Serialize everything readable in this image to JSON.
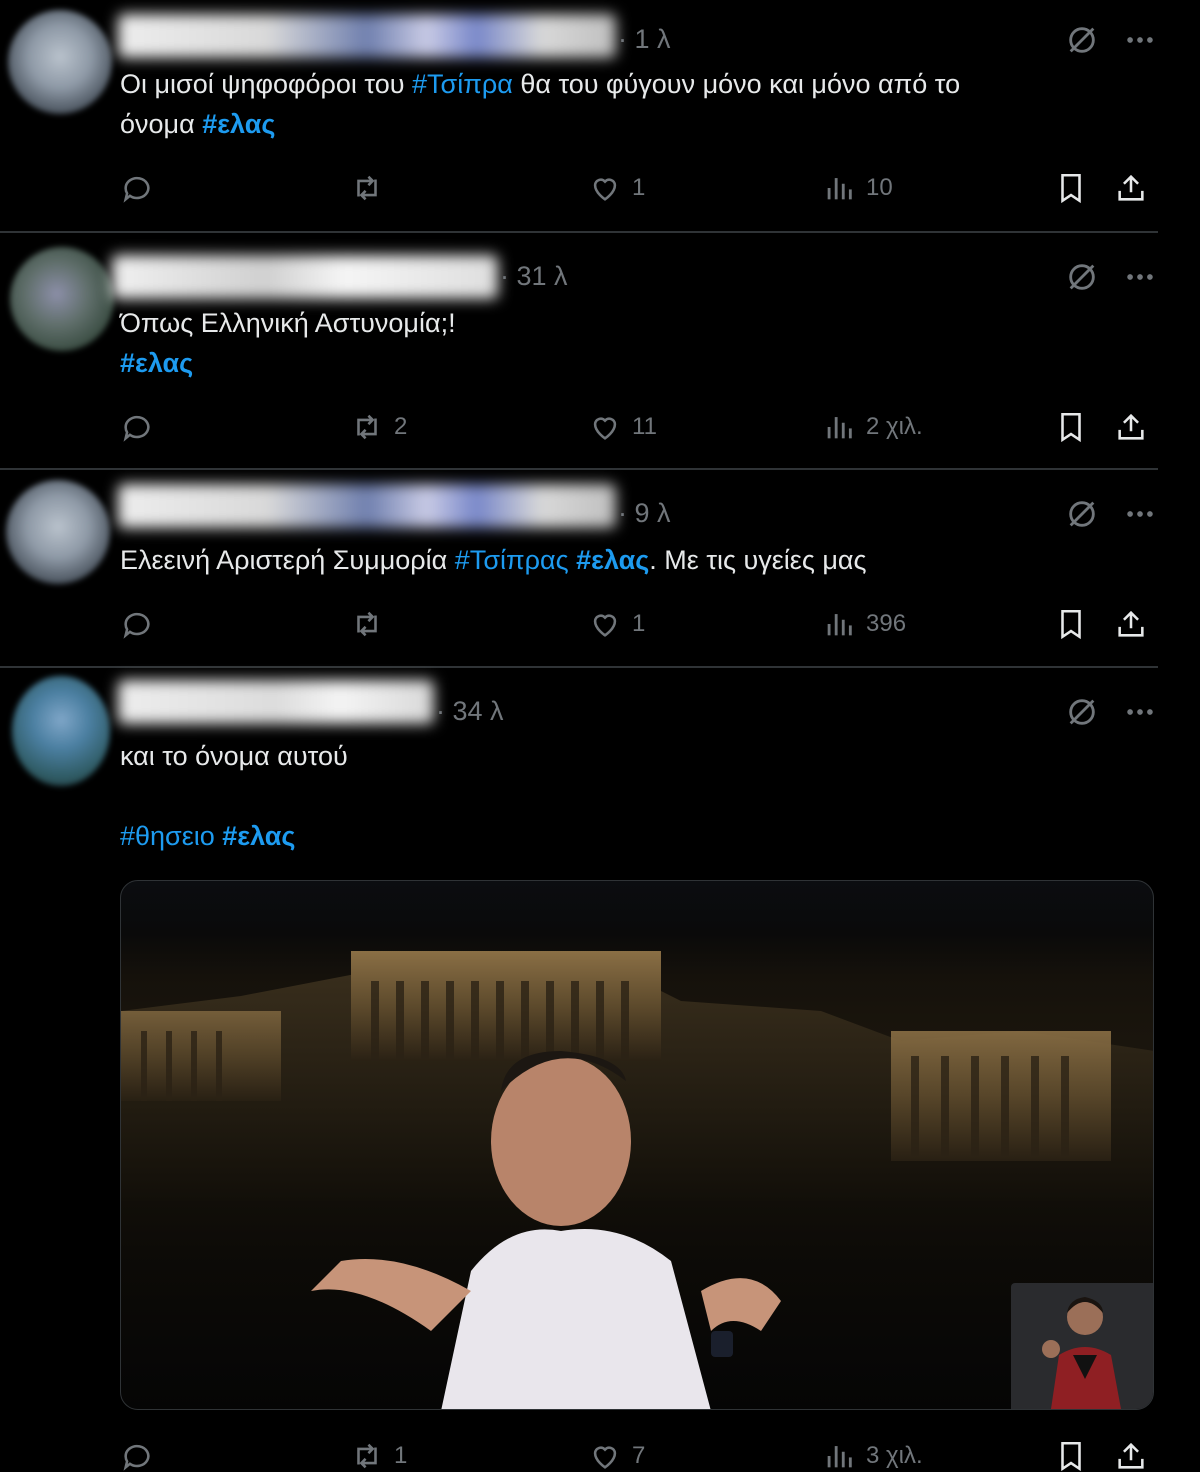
{
  "tweets": [
    {
      "time": "· 1 λ",
      "text_parts": [
        {
          "t": "Οι μισοί ψηφοφόροι του ",
          "tag": false
        },
        {
          "t": "#Τσίπρα",
          "tag": true,
          "bold": false
        },
        {
          "t": " θα του φύγουν μόνο και μόνο από το\nόνομα ",
          "tag": false
        },
        {
          "t": "#ελας",
          "tag": true,
          "bold": true
        }
      ],
      "replies": "",
      "reposts": "",
      "likes": "1",
      "views": "10"
    },
    {
      "time": "· 31 λ",
      "text_parts": [
        {
          "t": "Όπως Ελληνική Αστυνομία;!\n",
          "tag": false
        },
        {
          "t": "#ελας",
          "tag": true,
          "bold": true
        }
      ],
      "replies": "",
      "reposts": "2",
      "likes": "11",
      "views": "2 χιλ."
    },
    {
      "time": "· 9 λ",
      "text_parts": [
        {
          "t": "Ελεεινή Αριστερή Συμμορία ",
          "tag": false
        },
        {
          "t": "#Τσίπρας",
          "tag": true,
          "bold": false
        },
        {
          "t": " ",
          "tag": false
        },
        {
          "t": "#ελας",
          "tag": true,
          "bold": true
        },
        {
          "t": ". Με τις υγείες μας",
          "tag": false
        }
      ],
      "replies": "",
      "reposts": "",
      "likes": "1",
      "views": "396"
    },
    {
      "time": "· 34 λ",
      "text_parts": [
        {
          "t": "και το όνομα αυτού\n\n",
          "tag": false
        },
        {
          "t": "#θησειο",
          "tag": true,
          "bold": false
        },
        {
          "t": " ",
          "tag": false
        },
        {
          "t": "#ελας",
          "tag": true,
          "bold": true
        }
      ],
      "replies": "",
      "reposts": "1",
      "likes": "7",
      "views": "3 χιλ."
    }
  ],
  "icons": {
    "grok": "grok-icon",
    "more": "more-icon",
    "reply": "reply-icon",
    "repost": "repost-icon",
    "like": "heart-icon",
    "views": "views-icon",
    "bookmark": "bookmark-icon",
    "share": "share-icon"
  },
  "colors": {
    "background": "#000000",
    "text": "#e7e9ea",
    "muted": "#71767b",
    "link": "#1d9bf0",
    "divider": "#2f3336"
  }
}
